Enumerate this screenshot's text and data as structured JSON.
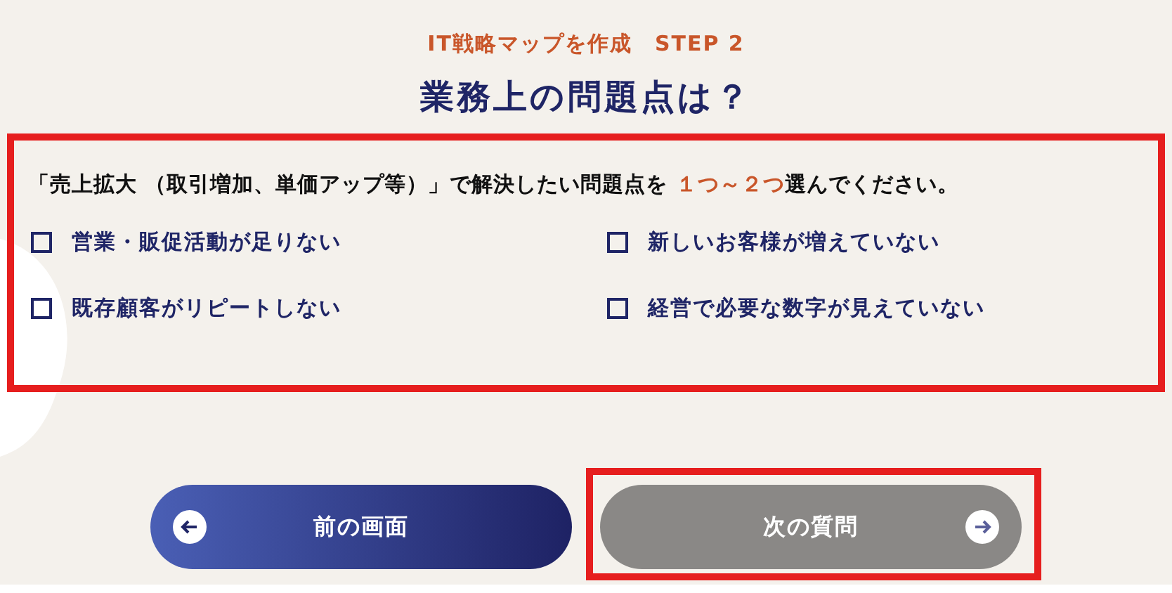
{
  "header": {
    "subtitle": "IT戦略マップを作成　STEP 2",
    "title": "業務上の問題点は？"
  },
  "question": {
    "highlighted": true,
    "instruction": {
      "before": "「売上拡大 （取引増加、単価アップ等）」で解決したい問題点を ",
      "emphasis": "１つ～２つ",
      "after": "選んでください。"
    },
    "options": [
      {
        "label": "営業・販促活動が足りない",
        "checked": false
      },
      {
        "label": "新しいお客様が増えていない",
        "checked": false
      },
      {
        "label": "既存顧客がリピートしない",
        "checked": false
      },
      {
        "label": "経営で必要な数字が見えていない",
        "checked": false
      }
    ]
  },
  "buttons": [
    {
      "kind": "back",
      "label": "前の画面",
      "disabled": false,
      "highlighted": false
    },
    {
      "kind": "next",
      "label": "次の質問",
      "disabled": true,
      "highlighted": true
    }
  ]
}
